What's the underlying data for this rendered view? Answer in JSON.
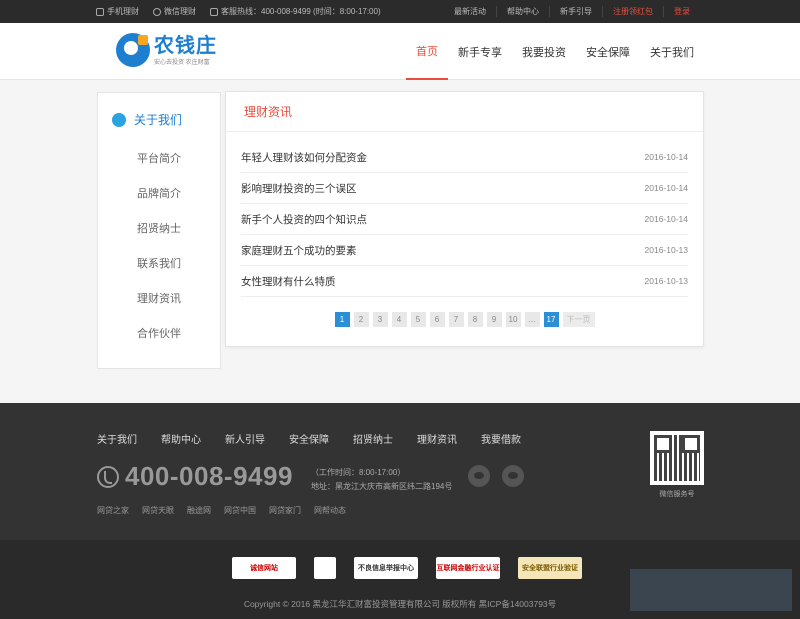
{
  "topbar": {
    "mobile": "手机理财",
    "wechat": "微信理财",
    "hotline": "客服热线：400-008-9499 (时间：8:00-17:00)",
    "links": [
      {
        "label": "最新活动"
      },
      {
        "label": "帮助中心"
      },
      {
        "label": "新手引导"
      },
      {
        "label": "注册领红包"
      },
      {
        "label": "登录"
      }
    ]
  },
  "header": {
    "brand": "农钱庄",
    "slogan": "安心去投资  农庄财富",
    "nav": [
      {
        "label": "首页"
      },
      {
        "label": "新手专享"
      },
      {
        "label": "我要投资"
      },
      {
        "label": "安全保障"
      },
      {
        "label": "关于我们"
      }
    ]
  },
  "sidebar": {
    "title": "关于我们",
    "items": [
      {
        "label": "平台简介"
      },
      {
        "label": "品牌简介"
      },
      {
        "label": "招贤纳士"
      },
      {
        "label": "联系我们"
      },
      {
        "label": "理财资讯"
      },
      {
        "label": "合作伙伴"
      }
    ]
  },
  "main": {
    "title": "理财资讯",
    "news": [
      {
        "title": "年轻人理财该如何分配资金",
        "date": "2016-10-14"
      },
      {
        "title": "影响理财投资的三个误区",
        "date": "2016-10-14"
      },
      {
        "title": "新手个人投资的四个知识点",
        "date": "2016-10-14"
      },
      {
        "title": "家庭理财五个成功的要素",
        "date": "2016-10-13"
      },
      {
        "title": "女性理财有什么特质",
        "date": "2016-10-13"
      }
    ],
    "pager": {
      "pages": [
        "1",
        "2",
        "3",
        "4",
        "5",
        "6",
        "7",
        "8",
        "9",
        "10",
        "...",
        "17"
      ],
      "current": "1",
      "next": "下一页"
    }
  },
  "footer": {
    "links": [
      {
        "label": "关于我们"
      },
      {
        "label": "帮助中心"
      },
      {
        "label": "新人引导"
      },
      {
        "label": "安全保障"
      },
      {
        "label": "招贤纳士"
      },
      {
        "label": "理财资讯"
      },
      {
        "label": "我要借款"
      }
    ],
    "phone": "400-008-9499",
    "hours": "（工作时间：8:00-17:00）",
    "address": "地址：黑龙江大庆市高新区纬二路194号",
    "friends": [
      {
        "label": "网贷之家"
      },
      {
        "label": "网贷天眼"
      },
      {
        "label": "融途网"
      },
      {
        "label": "网贷中国"
      },
      {
        "label": "网贷家门"
      },
      {
        "label": "网帮动态"
      }
    ],
    "qr_caption": "微信服务号",
    "badges": {
      "b1": "诚信网站",
      "b2": "",
      "b3": "不良信息举报中心",
      "b4": "互联网金融行业认证",
      "b5": "安全联盟行业验证"
    },
    "copyright": "Copyright © 2016 黑龙江华汇财富投资管理有限公司 版权所有 黑ICP备14003793号"
  },
  "colors": {
    "accent_red": "#e84c3d",
    "brand_blue": "#1e7fd0",
    "page_active": "#2a8fd4"
  }
}
